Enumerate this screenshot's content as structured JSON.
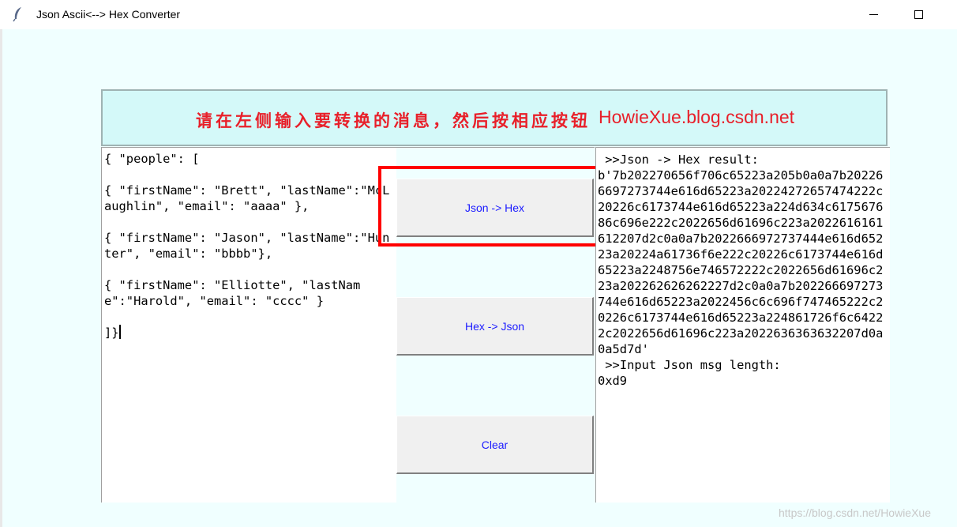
{
  "window": {
    "title": "Json Ascii<--> Hex Converter",
    "icon": "feather-icon"
  },
  "banner": {
    "instruction": "请在左侧输入要转换的消息，然后按相应按钮",
    "url": "HowieXue.blog.csdn.net",
    "text_color": "#e8202a",
    "background_color": "#d4f9f9"
  },
  "input": {
    "lines": [
      "{ \"people\": [",
      "",
      "{ \"firstName\": \"Brett\", \"lastName\":\"McLaughlin\", \"email\": \"aaaa\" },",
      "",
      "{ \"firstName\": \"Jason\", \"lastName\":\"Hunter\", \"email\": \"bbbb\"},",
      "",
      "{ \"firstName\": \"Elliotte\", \"lastName\":\"Harold\", \"email\": \"cccc\" }",
      "",
      "]}"
    ]
  },
  "buttons": {
    "json_to_hex": "Json -> Hex",
    "hex_to_json": "Hex -> Json",
    "clear": "Clear",
    "label_color": "#1b1bff"
  },
  "result": {
    "hex_header": " >>Json -> Hex result:",
    "hex_value": "b'7b202270656f706c65223a205b0a0a7b202266697273744e616d65223a20224272657474222c20226c6173744e616d65223a224d634c617567686c696e222c2022656d61696c223a2022616161612207d2c0a0a7b2022666972737444e616d65223a20224a61736f6e222c20226c6173744e616d65223a2248756e746572222c2022656d61696c223a202262626262227d2c0a0a7b202266697273744e616d65223a2022456c6c696f747465222c20226c6173744e616d65223a224861726f6c64222c2022656d61696c223a2022636363632207d0a0a5d7d'",
    "length_header": " >>Input Json msg length:",
    "length_value": "0xd9"
  },
  "highlight_color": "#ff0000",
  "watermark": "https://blog.csdn.net/HowieXue"
}
